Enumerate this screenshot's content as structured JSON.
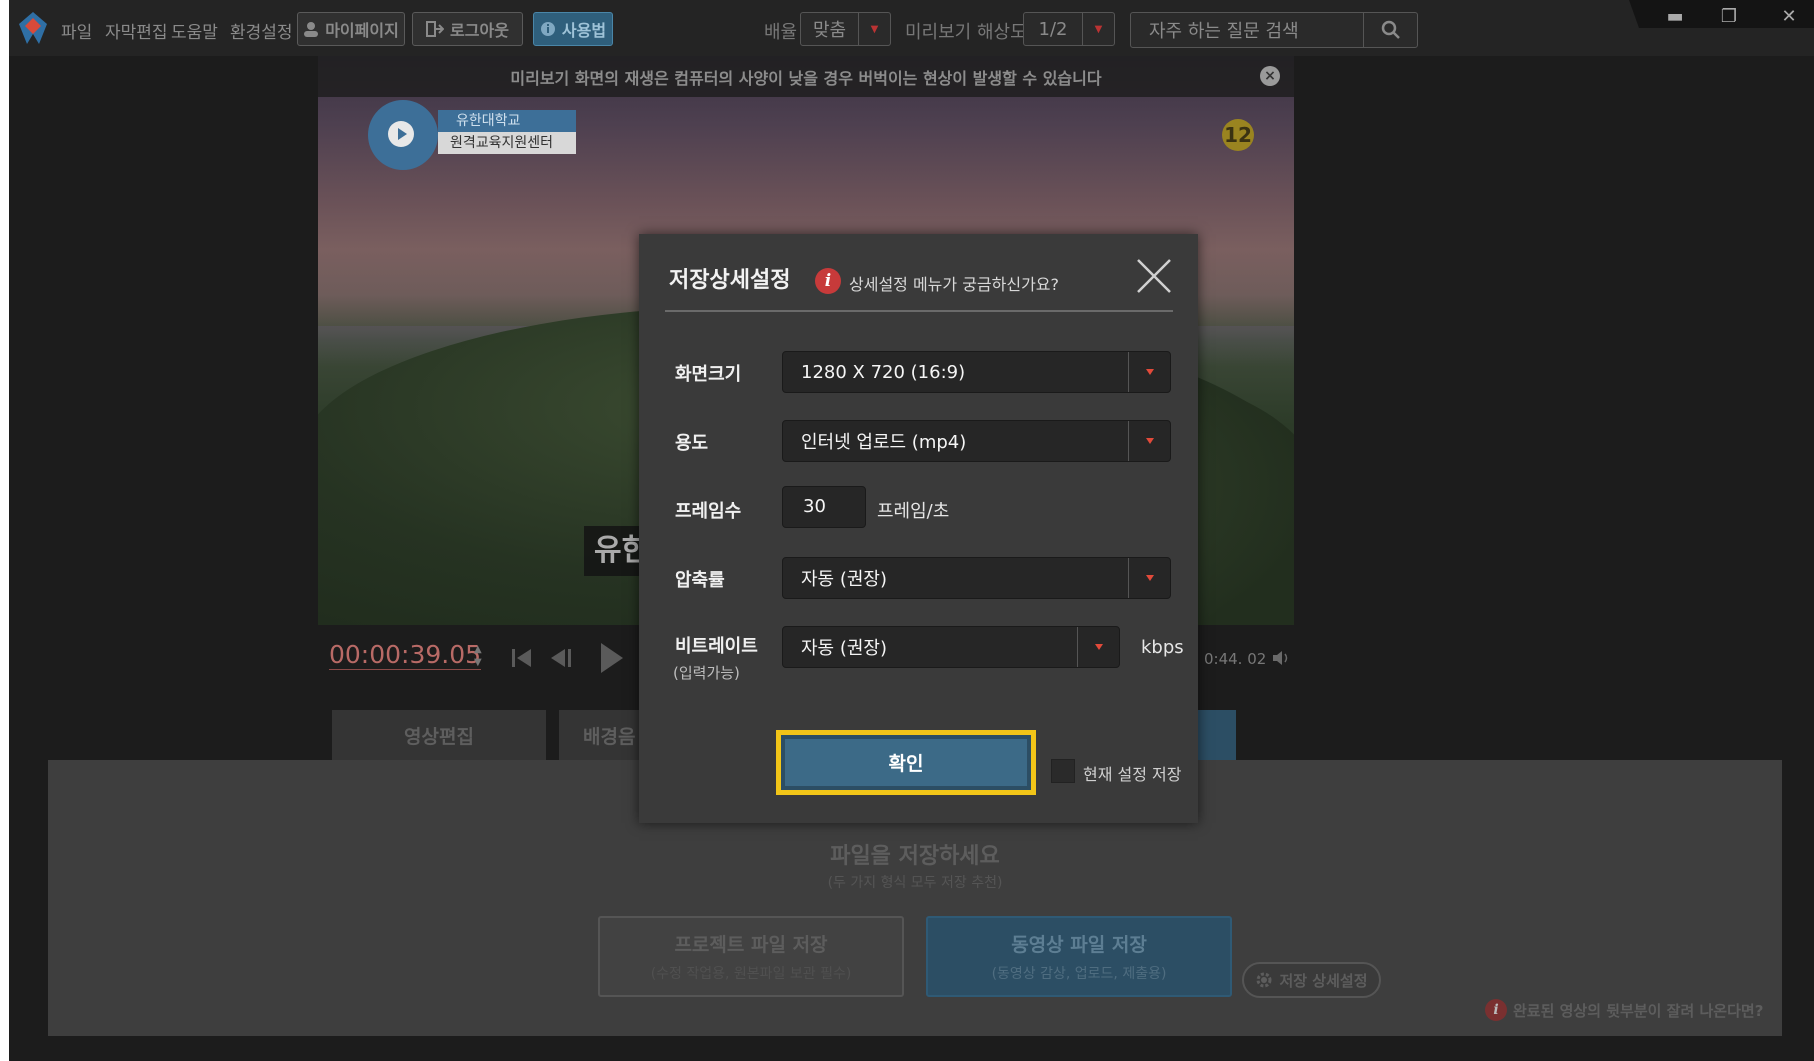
{
  "menu": {
    "items": [
      "파일",
      "자막편집",
      "도움말",
      "환경설정"
    ],
    "mypage_label": "마이페이지",
    "logout_label": "로그아웃",
    "howto_label": "사용법",
    "speed_label": "배율",
    "speed_value": "맞춤",
    "resolution_label": "미리보기 해상도",
    "resolution_value": "1/2",
    "faq_placeholder": "자주 하는 질문 검색"
  },
  "video": {
    "notice": "미리보기 화면의 재생은 컴퓨터의 사양이 낮을 경우 버벅이는 현상이 발생할 수 있습니다",
    "badge_line1": "유한대학교",
    "badge_line2": "원격교육지원센터",
    "rating": "12",
    "subtitle_fragment": "유한"
  },
  "playback": {
    "timecode": "00:00:39.05",
    "duration": "0:44. 02"
  },
  "tabs": [
    "영상편집",
    "배경음"
  ],
  "save_panel": {
    "title": "파일을 저장하세요",
    "subtitle": "(두 가지 형식 모두 저장 추천)",
    "project_button": "프로젝트 파일 저장",
    "project_sub": "(수정 작업용, 원본파일 보관 필수)",
    "video_button": "동영상 파일 저장",
    "video_sub": "(동영상 감상, 업로드, 제출용)",
    "advanced_button": "저장 상세설정",
    "cut_help": "완료된 영상의 뒷부분이 잘려 나온다면?"
  },
  "dialog": {
    "title": "저장상세설정",
    "help_text": "상세설정 메뉴가 궁금하신가요?",
    "fields": {
      "resolution": {
        "label": "화면크기",
        "value": "1280 X 720 (16:9)"
      },
      "purpose": {
        "label": "용도",
        "value": "인터넷 업로드 (mp4)"
      },
      "fps": {
        "label": "프레임수",
        "value": "30",
        "unit": "프레임/초"
      },
      "compression": {
        "label": "압축률",
        "value": "자동 (권장)"
      },
      "bitrate": {
        "label": "비트레이트",
        "sublabel": "(입력가능)",
        "value": "자동 (권장)",
        "unit": "kbps"
      }
    },
    "confirm_label": "확인",
    "save_current_label": "현재 설정 저장"
  },
  "colors": {
    "accent_blue": "#3c6a87",
    "highlight_yellow": "#f2c518",
    "help_red": "#c73a3a"
  }
}
